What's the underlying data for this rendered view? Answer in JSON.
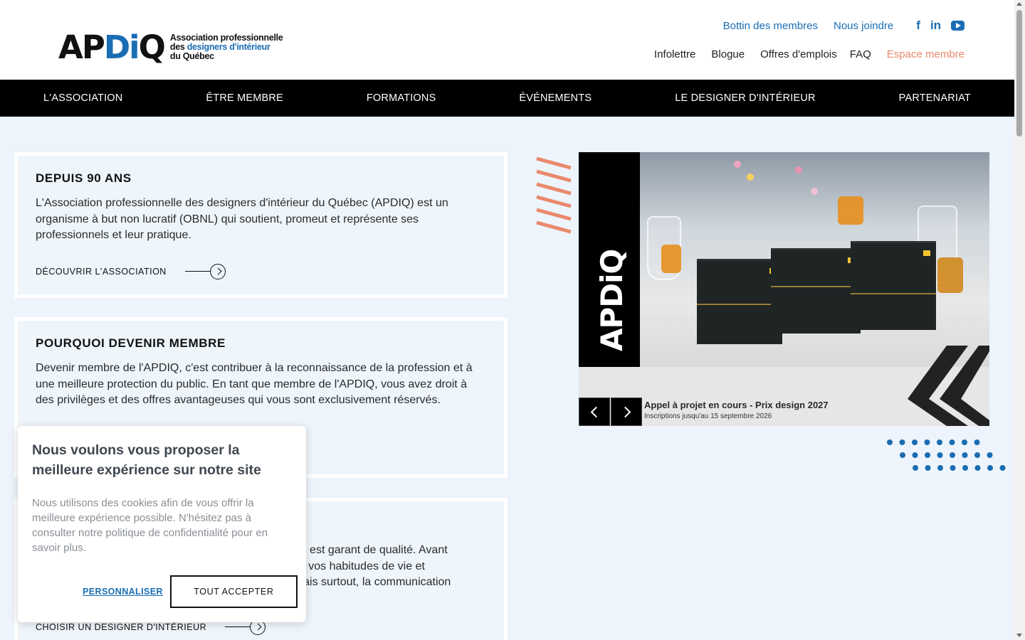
{
  "header": {
    "logo": {
      "mark": "APDiQ",
      "line1": "Association professionnelle",
      "line2_a": "des ",
      "line2_b": "designers d'intérieur",
      "line3": "du Québec"
    },
    "top_links": [
      "Bottin des membres",
      "Nous joindre"
    ],
    "social_icons": [
      "facebook-icon",
      "linkedin-icon",
      "youtube-icon"
    ],
    "secondary_links": [
      "Infolettre",
      "Blogue",
      "Offres d'emplois",
      "FAQ",
      "Espace membre"
    ]
  },
  "nav": {
    "items": [
      "L'ASSOCIATION",
      "ÊTRE MEMBRE",
      "FORMATIONS",
      "ÉVÉNEMENTS",
      "LE DESIGNER D'INTÉRIEUR",
      "PARTENARIAT"
    ]
  },
  "cards": [
    {
      "title": "DEPUIS 90 ANS",
      "text": "L'Association professionnelle des designers d'intérieur du Québec (APDIQ) est un organisme à but non lucratif (OBNL) qui soutient, promeut et représente ses professionnels et leur pratique.",
      "link": "DÉCOUVRIR L'ASSOCIATION"
    },
    {
      "title": "POURQUOI DEVENIR MEMBRE",
      "text": "Devenir membre de l'APDIQ, c'est contribuer à la reconnaissance de la profession et à une meilleure protection du public. En tant que membre de l'APDIQ, vous avez droit à des privilèges et des offres avantageuses qui vous sont exclusivement réservés."
    },
    {
      "text_visible": "onnu est garant de qualité. Avant\noins, vos habitudes de vie et\np. Mais surtout, la communication",
      "link": "CHOISIR UN DESIGNER D'INTÉRIEUR"
    }
  ],
  "slider": {
    "brand": "APDiQ",
    "title": "Appel à projet en cours - Prix design 2027",
    "subtitle": "Inscriptions jusqu'au 15 septembre 2026"
  },
  "cookie": {
    "title": "Nous voulons vous proposer la meilleure expérience sur notre site",
    "text": "Nous utilisons des cookies afin de vous offrir la meilleure expérience possible. N'hésitez pas à consulter notre politique de confidentialité pour en savoir plus.",
    "customize": "PERSONNALISER",
    "accept": "TOUT ACCEPTER"
  },
  "colors": {
    "brand_blue": "#1a6db3",
    "accent_orange": "#e9896b",
    "nav_bg": "#000000",
    "page_bg": "#edf4fb"
  }
}
